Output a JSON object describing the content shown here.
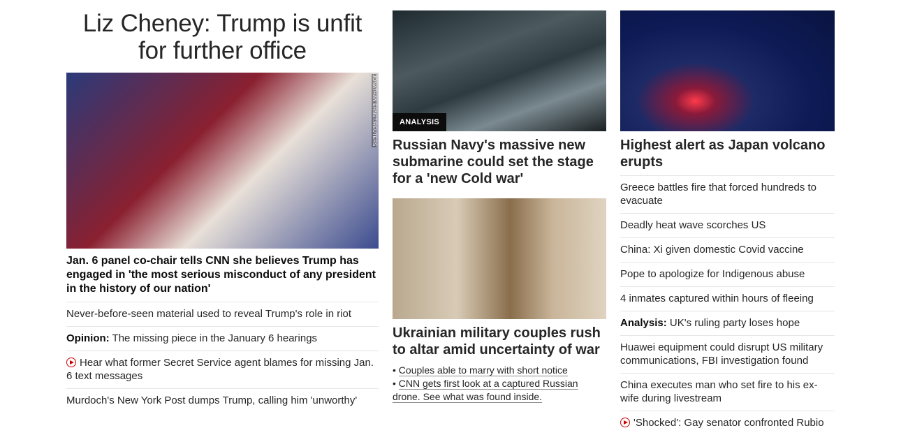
{
  "hero": {
    "title": "Liz Cheney: Trump is unfit for further office",
    "image_credit": "JONATHAN ERNST/REUTERS",
    "lead": "Jan. 6 panel co-chair tells CNN she believes Trump has engaged in 'the most serious misconduct of any president in the history of our nation'",
    "links": [
      {
        "prefix": "",
        "text": "Never-before-seen material used to reveal Trump's role in riot",
        "video": false
      },
      {
        "prefix": "Opinion:",
        "text": " The missing piece in the January 6 hearings",
        "video": false
      },
      {
        "prefix": "",
        "text": "Hear what former Secret Service agent blames for missing Jan. 6 text messages",
        "video": true
      },
      {
        "prefix": "",
        "text": "Murdoch's New York Post dumps Trump, calling him 'unworthy'",
        "video": false
      }
    ]
  },
  "middle": {
    "card1": {
      "badge": "ANALYSIS",
      "headline": "Russian Navy's massive new submarine could set the stage for a 'new Cold war'"
    },
    "card2": {
      "headline": "Ukrainian military couples rush to altar amid uncertainty of war",
      "bullets": [
        "Couples able to marry with short notice",
        "CNN gets first look at a captured Russian drone. See what was found inside."
      ]
    }
  },
  "right": {
    "card": {
      "headline": "Highest alert as Japan volcano erupts"
    },
    "links": [
      {
        "prefix": "",
        "text": "Greece battles fire that forced hundreds to evacuate",
        "video": false
      },
      {
        "prefix": "",
        "text": "Deadly heat wave scorches US",
        "video": false
      },
      {
        "prefix": "",
        "text": "China: Xi given domestic Covid vaccine",
        "video": false
      },
      {
        "prefix": "",
        "text": "Pope to apologize for Indigenous abuse",
        "video": false
      },
      {
        "prefix": "",
        "text": "4 inmates captured within hours of fleeing",
        "video": false
      },
      {
        "prefix": "Analysis:",
        "text": " UK's ruling party loses hope",
        "video": false
      },
      {
        "prefix": "",
        "text": "Huawei equipment could disrupt US military communications, FBI investigation found",
        "video": false
      },
      {
        "prefix": "",
        "text": "China executes man who set fire to his ex-wife during livestream",
        "video": false
      },
      {
        "prefix": "",
        "text": "'Shocked': Gay senator confronted Rubio",
        "video": true
      }
    ]
  },
  "colors": {
    "accent_red": "#cc0000",
    "text": "#0c0c0c",
    "divider": "#e6e6e6"
  }
}
